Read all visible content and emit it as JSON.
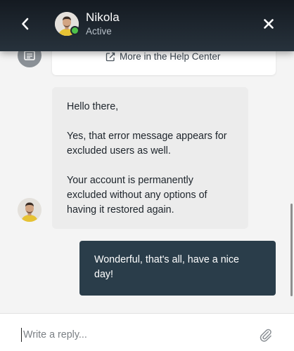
{
  "header": {
    "agent_name": "Nikola",
    "agent_status": "Active",
    "back_icon": "chevron-left-icon",
    "close_icon": "close-icon",
    "status_color": "#4fc14a"
  },
  "help_center": {
    "link_label": "More in the Help Center",
    "icon": "external-link-icon",
    "article_icon": "article-icon"
  },
  "messages": [
    {
      "sender": "agent",
      "paragraphs": [
        "Hello there,",
        "Yes, that error message appears for excluded users as well.",
        "Your account is permanently excluded without any options of having it restored again."
      ]
    },
    {
      "sender": "user",
      "text": "Wonderful, that's all, have a nice day!"
    }
  ],
  "composer": {
    "placeholder": "Write a reply...",
    "attach_icon": "paperclip-icon"
  },
  "colors": {
    "header_bg": "#1a2229",
    "agent_bubble": "#ececec",
    "user_bubble": "#2a3d4a"
  }
}
